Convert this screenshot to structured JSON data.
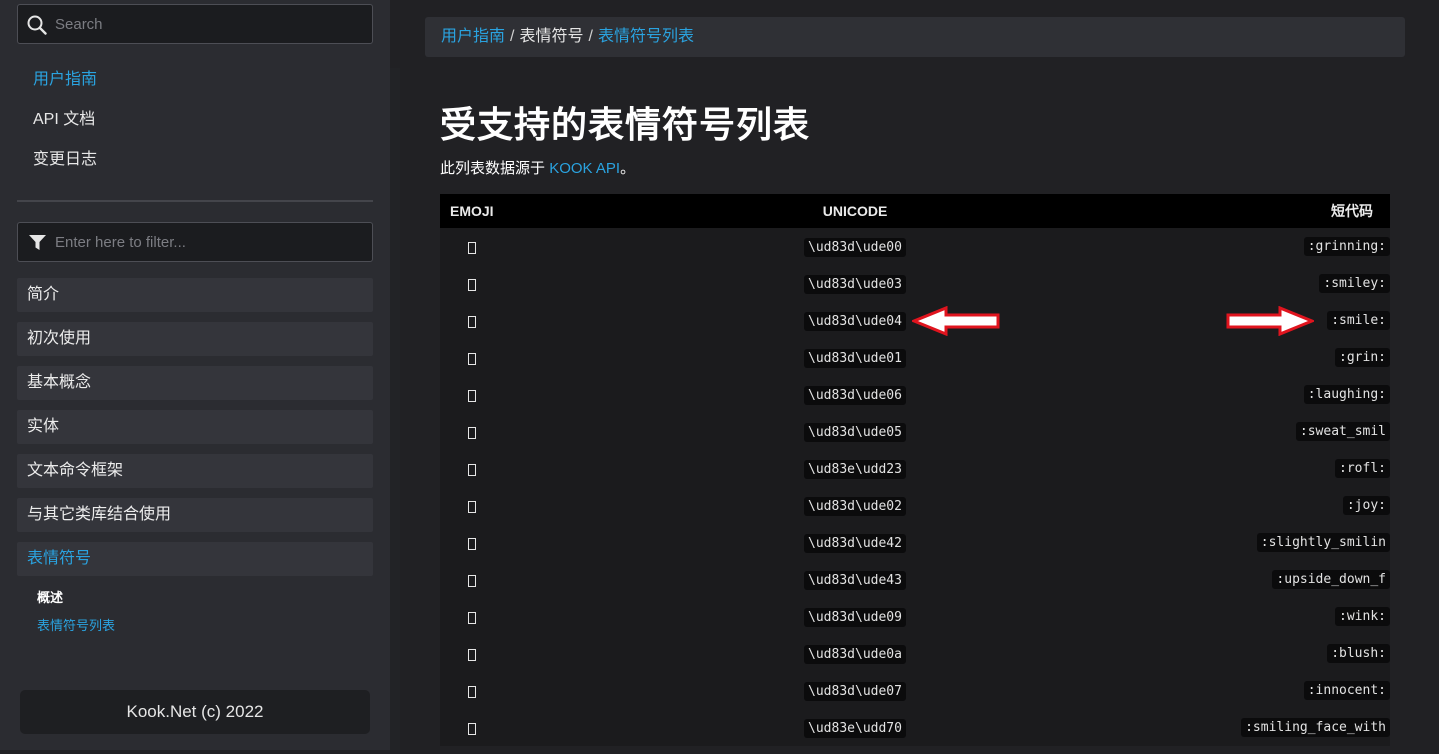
{
  "sidebar": {
    "search_placeholder": "Search",
    "top_nav": [
      {
        "label": "用户指南",
        "active": true
      },
      {
        "label": "API 文档",
        "active": false
      },
      {
        "label": "变更日志",
        "active": false
      }
    ],
    "filter_placeholder": "Enter here to filter...",
    "toc": [
      {
        "label": "简介"
      },
      {
        "label": "初次使用"
      },
      {
        "label": "基本概念"
      },
      {
        "label": "实体"
      },
      {
        "label": "文本命令框架"
      },
      {
        "label": "与其它类库结合使用"
      },
      {
        "label": "表情符号",
        "active": true
      }
    ],
    "sub_items": [
      {
        "label": "概述"
      },
      {
        "label": "表情符号列表",
        "active": true
      }
    ],
    "footer": "Kook.Net (c) 2022"
  },
  "breadcrumb": {
    "items": [
      "用户指南",
      "表情符号",
      "表情符号列表"
    ],
    "separator": "/"
  },
  "page": {
    "title": "受支持的表情符号列表",
    "subtitle_prefix": "此列表数据源于",
    "subtitle_link": "KOOK API",
    "subtitle_suffix": "。"
  },
  "table": {
    "headers": {
      "emoji": "EMOJI",
      "unicode": "UNICODE",
      "shortcode": "短代码"
    },
    "rows": [
      {
        "unicode": "\\ud83d\\ude00",
        "shortcode": ":grinning:"
      },
      {
        "unicode": "\\ud83d\\ude03",
        "shortcode": ":smiley:"
      },
      {
        "unicode": "\\ud83d\\ude04",
        "shortcode": ":smile:"
      },
      {
        "unicode": "\\ud83d\\ude01",
        "shortcode": ":grin:"
      },
      {
        "unicode": "\\ud83d\\ude06",
        "shortcode": ":laughing:"
      },
      {
        "unicode": "\\ud83d\\ude05",
        "shortcode": ":sweat_smil"
      },
      {
        "unicode": "\\ud83e\\udd23",
        "shortcode": ":rofl:"
      },
      {
        "unicode": "\\ud83d\\ude02",
        "shortcode": ":joy:"
      },
      {
        "unicode": "\\ud83d\\ude42",
        "shortcode": ":slightly_smilin"
      },
      {
        "unicode": "\\ud83d\\ude43",
        "shortcode": ":upside_down_f"
      },
      {
        "unicode": "\\ud83d\\ude09",
        "shortcode": ":wink:"
      },
      {
        "unicode": "\\ud83d\\ude0a",
        "shortcode": ":blush:"
      },
      {
        "unicode": "\\ud83d\\ude07",
        "shortcode": ":innocent:"
      },
      {
        "unicode": "\\ud83e\\udd70",
        "shortcode": ":smiling_face_with"
      }
    ]
  },
  "annotations": {
    "arrow_color": "#e0141e",
    "arrows": [
      "left-arrow-icon",
      "right-arrow-icon"
    ]
  }
}
